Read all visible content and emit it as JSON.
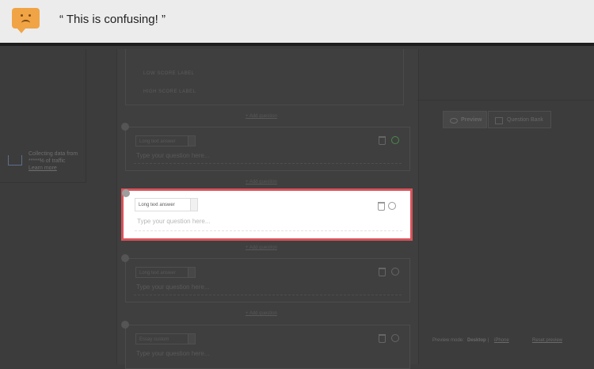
{
  "feedback": {
    "face_icon": "sad-face-icon",
    "accent": "#f0a445",
    "quote": "“ This is confusing! ”"
  },
  "sidebar": {
    "collect_line1": "Collecting data from",
    "collect_line2": "*****% of traffic",
    "learn_more": "Learn more"
  },
  "editor": {
    "score_labels": [
      "LOW SCORE LABEL",
      "HIGH SCORE LABEL"
    ],
    "add_question": "+ Add question",
    "questions": [
      {
        "type": "Long text answer",
        "placeholder": "Type your question here..."
      },
      {
        "type": "Long text answer",
        "placeholder": "Type your question here..."
      },
      {
        "type": "Long text answer",
        "placeholder": "Type your question here..."
      },
      {
        "type": "Essay custom",
        "placeholder": "Type your question here..."
      }
    ],
    "highlight_color": "#d8535b"
  },
  "preview_panel": {
    "preview_label": "Preview",
    "bank_label": "Question Bank",
    "mode_label": "Preview mode:",
    "mode_desktop": "Desktop",
    "separator": "|",
    "mode_iphone": "iPhone",
    "reset": "Reset preview"
  }
}
